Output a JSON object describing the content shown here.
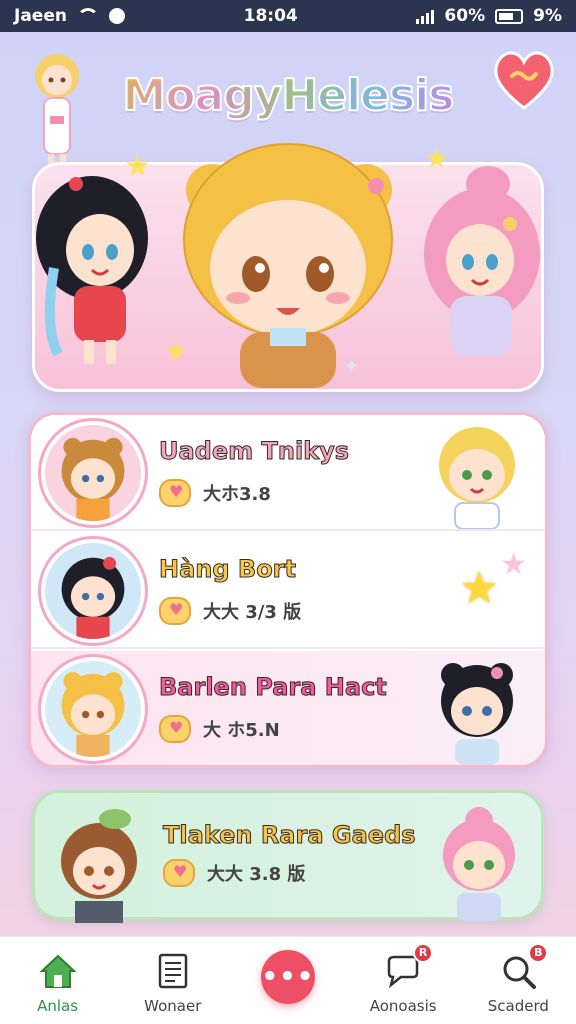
{
  "status_bar": {
    "carrier": "Jaeen",
    "time": "18:04",
    "battery_percent": "60%",
    "signal_text": "9%"
  },
  "header": {
    "logo_text": "MoagyHelesis",
    "heart_icon": "heart-icon"
  },
  "list": [
    {
      "title": "Uadem Tnikys",
      "subtitle": "大ホ3.8",
      "title_color": "#f2a6c6",
      "icon": "heart-bubble-icon"
    },
    {
      "title": "Hàng Bort",
      "subtitle": "大大 3/3 版",
      "title_color": "#f6c84b",
      "icon": "heart-bubble-icon"
    },
    {
      "title": "Barlen Para Hact",
      "subtitle": "大 ホ5.N",
      "title_color": "#ef5aa7",
      "icon": "heart-bubble-icon"
    }
  ],
  "featured": {
    "title": "Tlaken Rara Gaeds",
    "subtitle": "大大 3.8 版",
    "title_color": "#f4c34e",
    "icon": "heart-bubble-icon"
  },
  "tabbar": {
    "tabs": [
      {
        "label": "Anlas",
        "icon": "home-icon",
        "active": true
      },
      {
        "label": "Wonaer",
        "icon": "document-icon",
        "active": false
      },
      {
        "label": "",
        "icon": "more-icon",
        "active": false
      },
      {
        "label": "Aonoasis",
        "icon": "chat-icon",
        "active": false,
        "badge": "R"
      },
      {
        "label": "Scaderd",
        "icon": "search-icon",
        "active": false,
        "badge": "B"
      }
    ],
    "fab_glyph": "•••"
  },
  "colors": {
    "accent_pink": "#ee4f65",
    "active_green": "#2f8f44"
  }
}
